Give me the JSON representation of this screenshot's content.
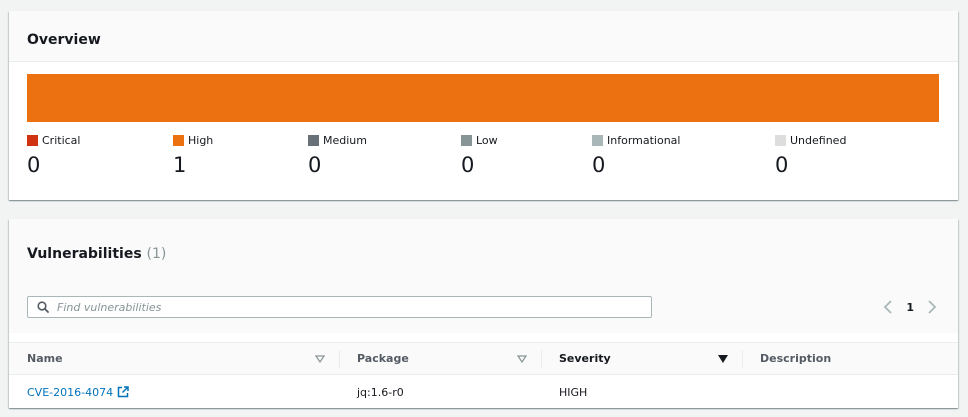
{
  "overview": {
    "title": "Overview",
    "bar": [
      {
        "severity": "Critical",
        "count": 0,
        "color": "#d13212"
      },
      {
        "severity": "High",
        "count": 1,
        "color": "#ec7211"
      },
      {
        "severity": "Medium",
        "count": 0,
        "color": "#687078"
      },
      {
        "severity": "Low",
        "count": 0,
        "color": "#879596"
      },
      {
        "severity": "Informational",
        "count": 0,
        "color": "#aab7b8"
      },
      {
        "severity": "Undefined",
        "count": 0,
        "color": "#dddddd"
      }
    ],
    "legend": [
      {
        "label": "Critical",
        "value": "0",
        "color": "#d13212"
      },
      {
        "label": "High",
        "value": "1",
        "color": "#ec7211"
      },
      {
        "label": "Medium",
        "value": "0",
        "color": "#687078"
      },
      {
        "label": "Low",
        "value": "0",
        "color": "#879596"
      },
      {
        "label": "Informational",
        "value": "0",
        "color": "#aab7b8"
      },
      {
        "label": "Undefined",
        "value": "0",
        "color": "#dddddd"
      }
    ]
  },
  "vulnerabilities": {
    "title": "Vulnerabilities",
    "count": "(1)",
    "search": {
      "placeholder": "Find vulnerabilities",
      "value": ""
    },
    "pagination": {
      "current_page": "1",
      "prev_icon": "chevron-left-icon",
      "next_icon": "chevron-right-icon"
    },
    "columns": [
      "Name",
      "Package",
      "Severity",
      "Description"
    ],
    "sorted_column": "Severity",
    "rows": [
      {
        "name": "CVE-2016-4074",
        "package": "jq:1.6-r0",
        "severity": "HIGH",
        "description": ""
      }
    ]
  }
}
